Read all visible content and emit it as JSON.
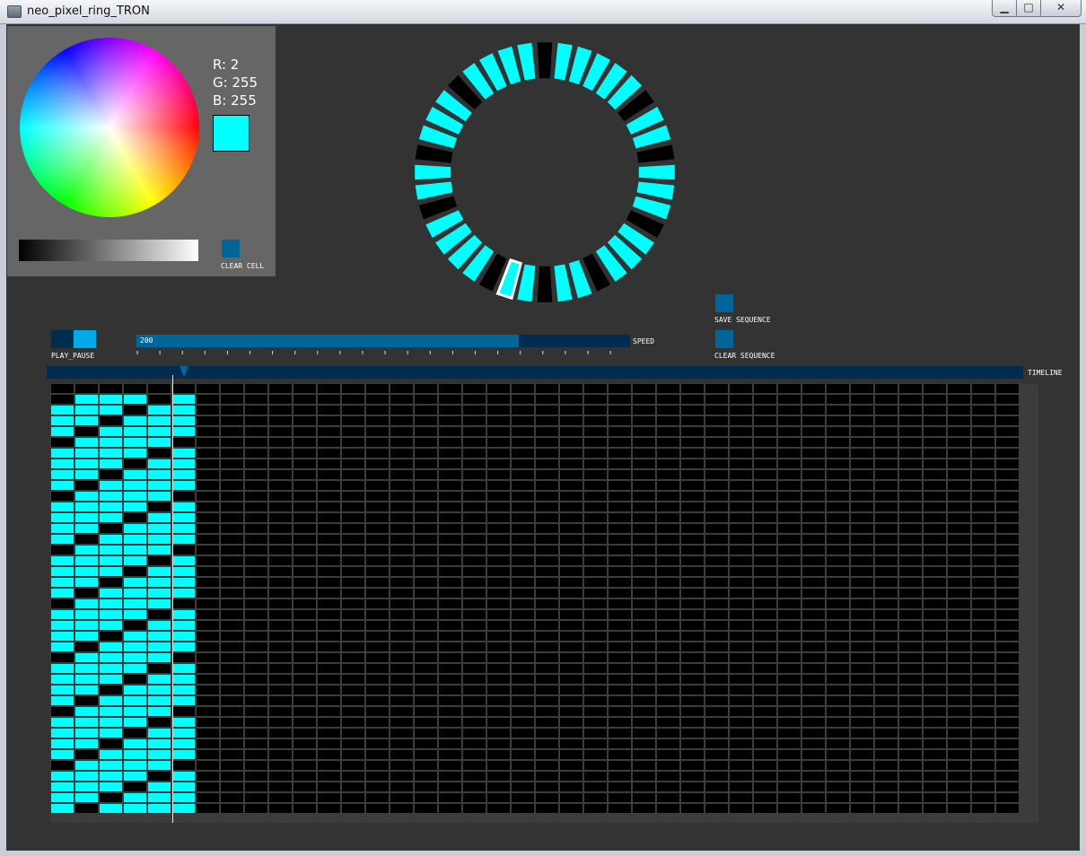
{
  "window": {
    "title": "neo_pixel_ring_TRON",
    "buttons": {
      "minimize": "▁",
      "maximize": "□",
      "close": "✕"
    }
  },
  "color_picker": {
    "r_label": "R: 2",
    "g_label": "G: 255",
    "b_label": "B: 255",
    "selected_color": "#02ffff",
    "clear_cell_label": "CLEAR CELL"
  },
  "ring": {
    "led_count": 40,
    "off_leds": [
      0,
      6,
      9,
      13,
      17,
      20,
      23,
      28,
      31,
      35
    ],
    "highlighted_led": 22,
    "on_color": "#00ffff",
    "off_color": "#000000"
  },
  "controls": {
    "play_pause_label": "PLAY_PAUSE",
    "speed_value": "200",
    "speed_fraction": 0.774,
    "speed_label": "SPEED",
    "save_sequence_label": "SAVE SEQUENCE",
    "clear_sequence_label": "CLEAR SEQUENCE",
    "timeline_label": "TIMELINE",
    "timeline_position_step": 5
  },
  "sequence": {
    "columns": 40,
    "rows": 40,
    "filled_columns": 6,
    "off_cells": [
      [
        0,
        1
      ],
      [
        4,
        1
      ],
      [
        3,
        2
      ],
      [
        2,
        3
      ],
      [
        1,
        4
      ],
      [
        0,
        5
      ],
      [
        5,
        5
      ],
      [
        4,
        6
      ],
      [
        3,
        7
      ],
      [
        2,
        8
      ],
      [
        1,
        9
      ],
      [
        0,
        10
      ],
      [
        5,
        10
      ],
      [
        4,
        11
      ],
      [
        3,
        12
      ],
      [
        2,
        13
      ],
      [
        1,
        14
      ],
      [
        0,
        15
      ],
      [
        5,
        15
      ],
      [
        4,
        16
      ],
      [
        3,
        17
      ],
      [
        2,
        18
      ],
      [
        1,
        19
      ],
      [
        0,
        20
      ],
      [
        5,
        20
      ],
      [
        4,
        21
      ],
      [
        3,
        22
      ],
      [
        2,
        23
      ],
      [
        1,
        24
      ],
      [
        0,
        25
      ],
      [
        5,
        25
      ],
      [
        4,
        26
      ],
      [
        3,
        27
      ],
      [
        2,
        28
      ],
      [
        1,
        29
      ],
      [
        0,
        30
      ],
      [
        5,
        30
      ],
      [
        4,
        31
      ],
      [
        3,
        32
      ],
      [
        2,
        33
      ],
      [
        1,
        34
      ],
      [
        0,
        35
      ],
      [
        5,
        35
      ],
      [
        4,
        36
      ],
      [
        3,
        37
      ],
      [
        2,
        38
      ],
      [
        1,
        39
      ]
    ],
    "cell_on_color": "#00ffff",
    "cell_off_color": "#000000",
    "grid_line_color": "#3c3c3c"
  }
}
